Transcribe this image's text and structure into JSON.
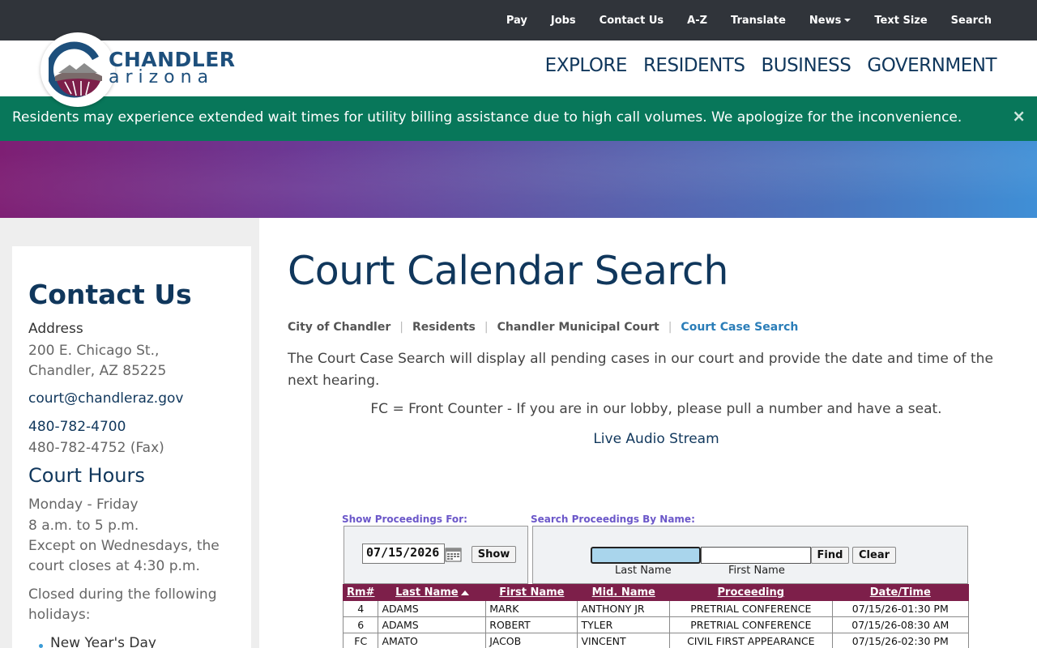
{
  "topnav": [
    {
      "label": "Pay",
      "caret": false
    },
    {
      "label": "Jobs",
      "caret": false
    },
    {
      "label": "Contact Us",
      "caret": false
    },
    {
      "label": "A-Z",
      "caret": false
    },
    {
      "label": "Translate",
      "caret": false
    },
    {
      "label": "News",
      "caret": true
    },
    {
      "label": "Text Size",
      "caret": false
    },
    {
      "label": "Search",
      "caret": false
    }
  ],
  "logo": {
    "top": "CHANDLER",
    "bottom": "arizona"
  },
  "mainnav": [
    "EXPLORE",
    "RESIDENTS",
    "BUSINESS",
    "GOVERNMENT"
  ],
  "alert": {
    "text": "Residents may experience extended wait times for utility billing assistance due to high call volumes. We apologize for the inconvenience.",
    "close": "×"
  },
  "sidebar": {
    "contact_heading": "Contact Us",
    "address_label": "Address",
    "address_line1": "200 E. Chicago St.,",
    "address_line2": "Chandler, AZ 85225",
    "email": "court@chandleraz.gov",
    "phone": "480-782-4700",
    "fax": "480-782-4752 (Fax)",
    "hours_heading": "Court Hours",
    "hours_days": "Monday - Friday",
    "hours_time": "8 a.m. to 5 p.m.",
    "hours_exception": "Except on Wednesdays, the court closes at 4:30 p.m.",
    "holidays_intro": "Closed during the following holidays:",
    "holidays": [
      "New Year's Day"
    ]
  },
  "main": {
    "title": "Court Calendar Search",
    "breadcrumb": [
      "City of Chandler",
      "Residents",
      "Chandler Municipal Court",
      "Court Case Search"
    ],
    "intro": "The Court Case Search will display all pending cases in our court and provide the date and time of the next hearing.",
    "fc_note": "FC = Front Counter - If you are in our lobby, please pull a number and have a seat.",
    "audio_link": "Live Audio Stream"
  },
  "calendar": {
    "show_label": "Show Proceedings For:",
    "search_label": "Search Proceedings By Name:",
    "date_value": "07/15/2026",
    "show_button": "Show",
    "find_button": "Find",
    "clear_button": "Clear",
    "last_name_label": "Last Name",
    "first_name_label": "First Name",
    "columns": [
      "Rm#",
      "Last Name",
      "First Name",
      "Mid. Name",
      "Proceeding",
      "Date/Time"
    ],
    "rows": [
      [
        "4",
        "ADAMS",
        "MARK",
        "ANTHONY JR",
        "PRETRIAL CONFERENCE",
        "07/15/26-01:30 PM"
      ],
      [
        "6",
        "ADAMS",
        "ROBERT",
        "TYLER",
        "PRETRIAL CONFERENCE",
        "07/15/26-08:30 AM"
      ],
      [
        "FC",
        "AMATO",
        "JACOB",
        "VINCENT",
        "CIVIL FIRST APPEARANCE",
        "07/15/26-02:30 PM"
      ]
    ]
  },
  "colors": {
    "topbar": "#30343a",
    "alert": "#08775a",
    "navy": "#10375c",
    "table_header": "#7d1f4a"
  }
}
